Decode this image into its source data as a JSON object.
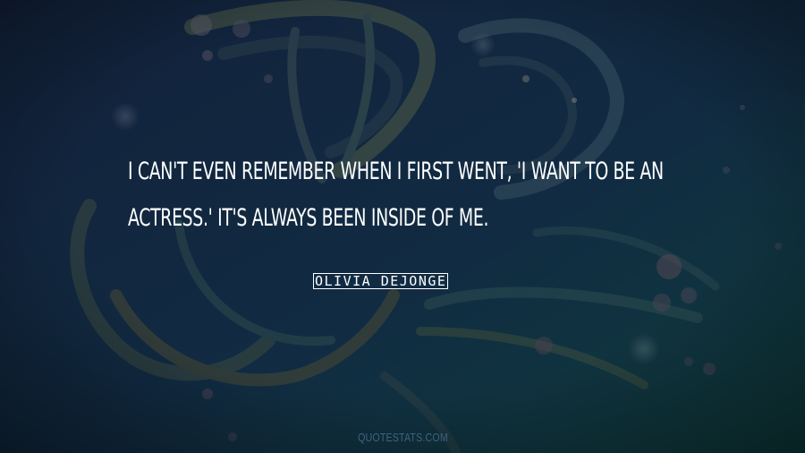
{
  "quote": {
    "lines": [
      "I CAN'T EVEN REMEMBER WHEN I FIRST WENT, 'I WANT TO BE AN",
      "ACTRESS.' IT'S ALWAYS BEEN INSIDE OF ME."
    ]
  },
  "author": {
    "name": "OLIVIA DEJONGE"
  },
  "watermark": {
    "text": "QUOTESTATS.COM"
  },
  "colors": {
    "background_top": "#13213a",
    "background_bottom": "#0f3a3c",
    "text": "#ffffff",
    "watermark": "#3f627e"
  },
  "background_art": {
    "subject": "butterfly-wing-silhouette"
  }
}
